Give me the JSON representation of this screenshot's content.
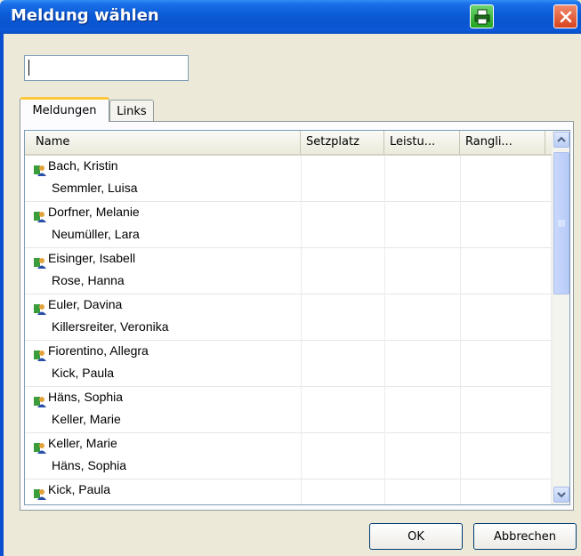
{
  "window": {
    "title": "Meldung wählen",
    "titlebar_color": "#0a55d0"
  },
  "search": {
    "value": "",
    "placeholder": ""
  },
  "tabs": [
    {
      "label": "Meldungen",
      "active": true
    },
    {
      "label": "Links",
      "active": false
    }
  ],
  "table": {
    "columns": [
      "Name",
      "Setzplatz",
      "Leistu...",
      "Rangli..."
    ],
    "rows": [
      {
        "player1": "Bach, Kristin",
        "player2": "Semmler, Luisa"
      },
      {
        "player1": "Dorfner, Melanie",
        "player2": "Neumüller, Lara"
      },
      {
        "player1": "Eisinger, Isabell",
        "player2": "Rose, Hanna"
      },
      {
        "player1": "Euler, Davina",
        "player2": "Killersreiter, Veronika"
      },
      {
        "player1": "Fiorentino, Allegra",
        "player2": "Kick, Paula"
      },
      {
        "player1": "Häns, Sophia",
        "player2": "Keller, Marie"
      },
      {
        "player1": "Keller, Marie",
        "player2": "Häns, Sophia"
      },
      {
        "player1": "Kick, Paula",
        "player2": ""
      }
    ],
    "row_icon": "person-icon"
  },
  "buttons": {
    "ok": "OK",
    "cancel": "Abbrechen"
  },
  "icons": {
    "print": "printer-icon",
    "close": "close-icon"
  }
}
